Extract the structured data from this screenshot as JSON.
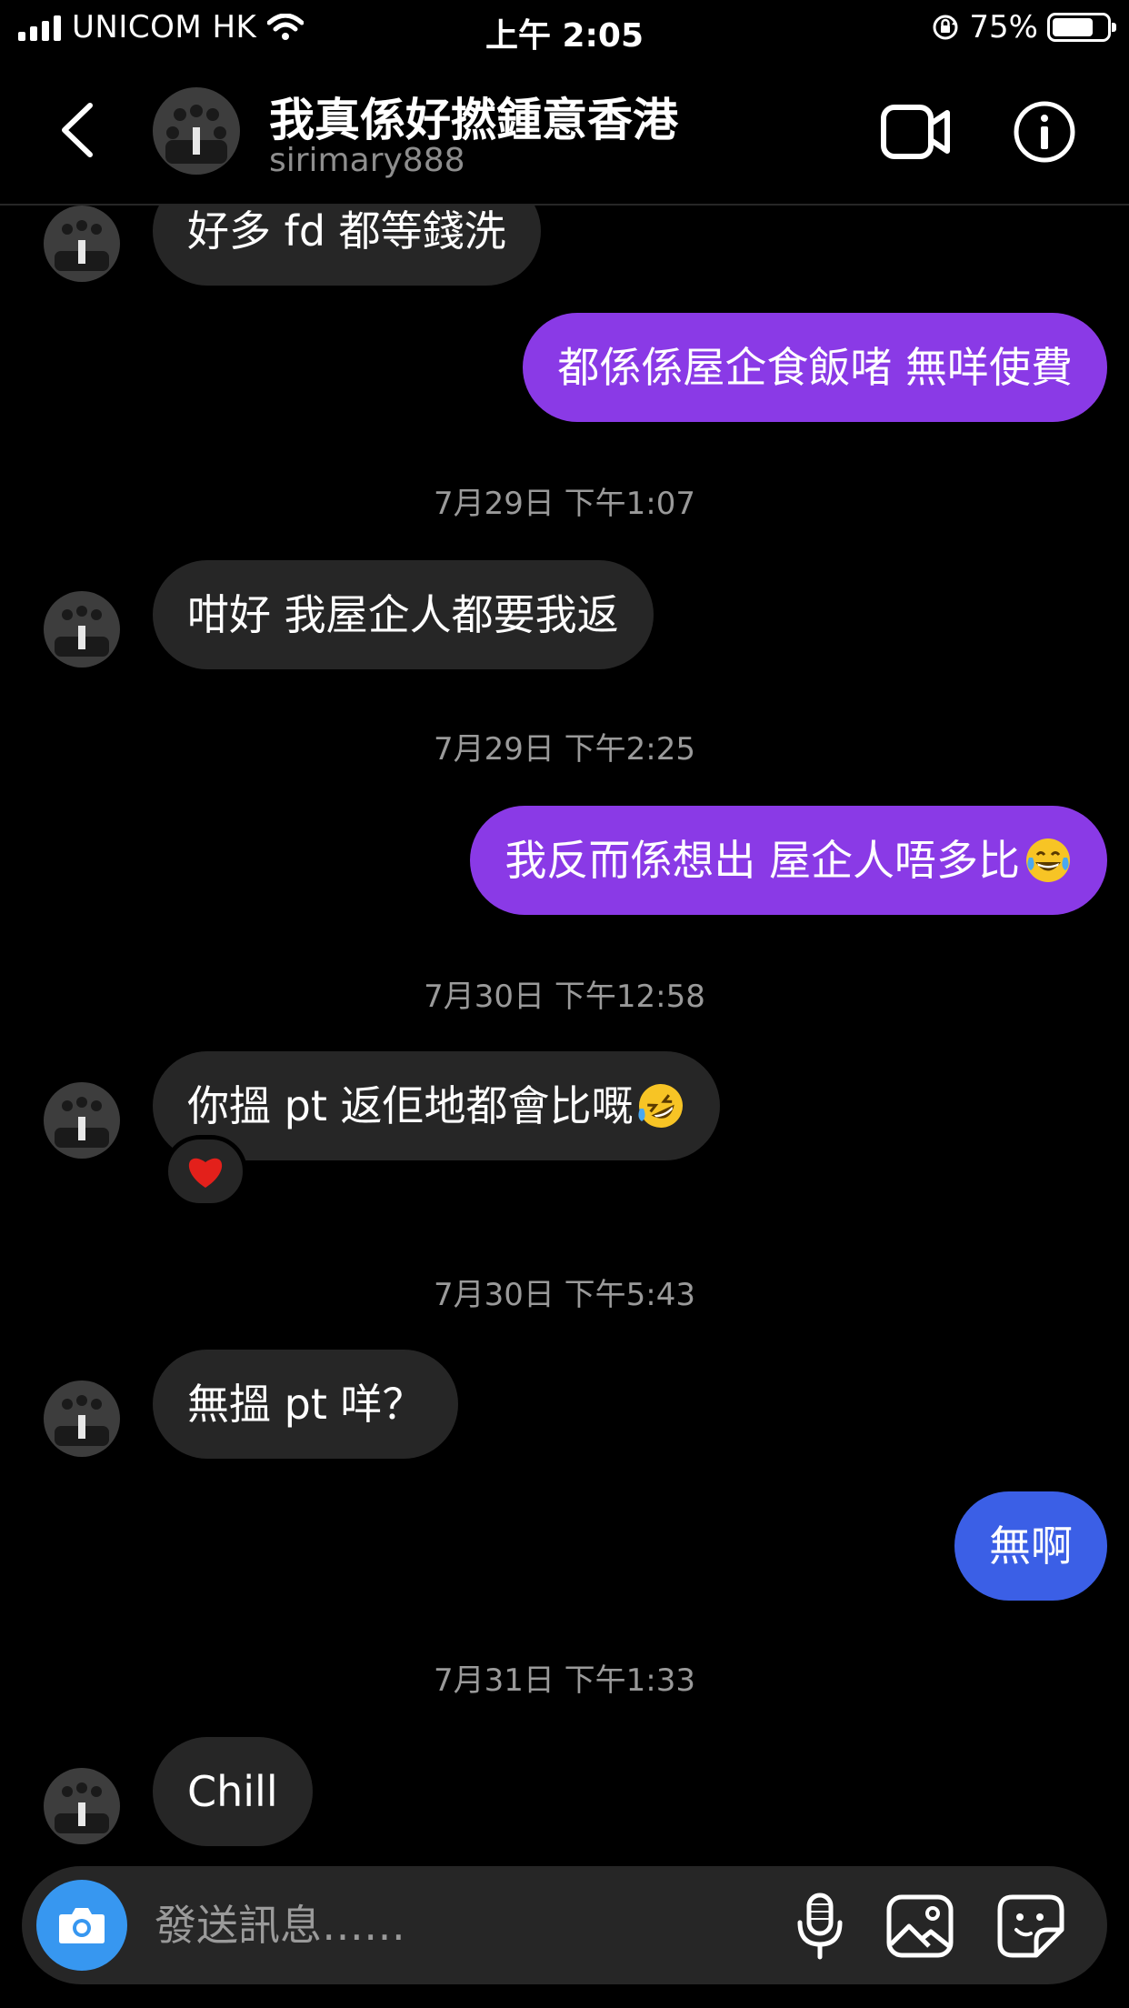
{
  "status_bar": {
    "carrier": "UNICOM HK",
    "time": "上午 2:05",
    "battery_text": "75%",
    "battery_level": 0.75
  },
  "header": {
    "title": "我真係好撚鍾意香港",
    "username": "sirimary888",
    "icons": [
      "chevron-left-icon",
      "video-camera-icon",
      "info-icon"
    ]
  },
  "messages": [
    {
      "kind": "message",
      "side": "in",
      "text": "好多 fd 都等錢洗"
    },
    {
      "kind": "message",
      "side": "out",
      "text": "都係係屋企食飯啫 無咩使費"
    },
    {
      "kind": "timestamp",
      "text": "7月29日 下午1:07"
    },
    {
      "kind": "message",
      "side": "in",
      "text": "咁好 我屋企人都要我返"
    },
    {
      "kind": "timestamp",
      "text": "7月29日 下午2:25"
    },
    {
      "kind": "message",
      "side": "out",
      "text": "我反而係想出 屋企人唔多比",
      "emoji": "tears-of-joy-emoji"
    },
    {
      "kind": "timestamp",
      "text": "7月30日 下午12:58"
    },
    {
      "kind": "message",
      "side": "in",
      "text": "你搵 pt 返佢地都會比嘅",
      "emoji": "rolling-laughing-emoji",
      "reaction": "red-heart-emoji"
    },
    {
      "kind": "timestamp",
      "text": "7月30日 下午5:43"
    },
    {
      "kind": "message",
      "side": "in",
      "text": "無搵 pt 咩？"
    },
    {
      "kind": "message",
      "side": "out",
      "text": "無啊"
    },
    {
      "kind": "timestamp",
      "text": "7月31日 下午1:33"
    },
    {
      "kind": "message",
      "side": "in",
      "text": "Chill"
    }
  ],
  "composer": {
    "placeholder": "發送訊息……",
    "icons": [
      "camera-icon",
      "microphone-icon",
      "image-gallery-icon",
      "sticker-icon"
    ]
  },
  "colors": {
    "background": "#000000",
    "incoming_bubble": "#262626",
    "outgoing_bubble": "#8a3ae6",
    "outgoing_bubble_last": "#3b5fe6",
    "timestamp_text": "#9a9a9a",
    "camera_button": "#3797f0"
  }
}
